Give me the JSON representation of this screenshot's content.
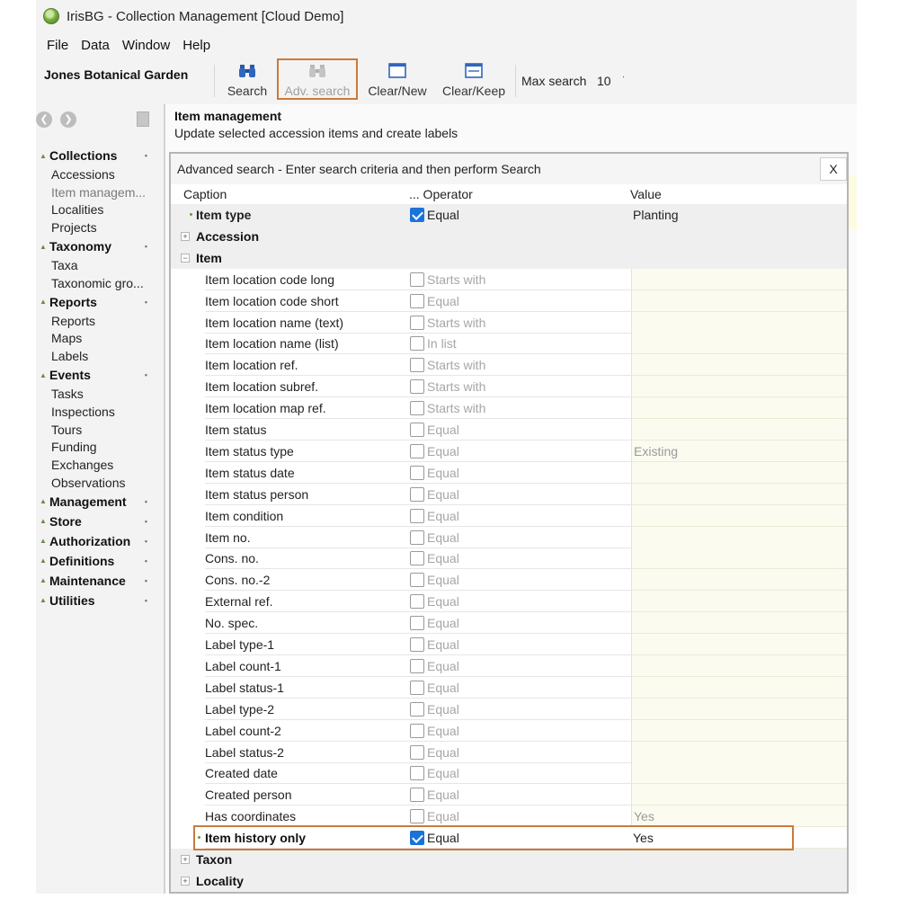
{
  "window": {
    "title": "IrisBG - Collection Management [Cloud Demo]"
  },
  "menu": [
    "File",
    "Data",
    "Window",
    "Help"
  ],
  "toolbar": {
    "org_name": "Jones Botanical Garden",
    "search_label": "Search",
    "adv_search_label": "Adv. search",
    "clear_new_label": "Clear/New",
    "clear_keep_label": "Clear/Keep",
    "max_search_label": "Max search",
    "max_search_value": "10"
  },
  "sidebar": {
    "groups": [
      {
        "label": "Collections",
        "items": [
          {
            "label": "Accessions",
            "dim": false
          },
          {
            "label": "Item managem...",
            "dim": true
          },
          {
            "label": "Localities",
            "dim": false
          },
          {
            "label": "Projects",
            "dim": false
          }
        ]
      },
      {
        "label": "Taxonomy",
        "items": [
          {
            "label": "Taxa",
            "dim": false
          },
          {
            "label": "Taxonomic gro...",
            "dim": false
          }
        ]
      },
      {
        "label": "Reports",
        "items": [
          {
            "label": "Reports",
            "dim": false
          },
          {
            "label": "Maps",
            "dim": false
          },
          {
            "label": "Labels",
            "dim": false
          }
        ]
      },
      {
        "label": "Events",
        "items": [
          {
            "label": "Tasks",
            "dim": false
          },
          {
            "label": "Inspections",
            "dim": false
          },
          {
            "label": "Tours",
            "dim": false
          },
          {
            "label": "Funding",
            "dim": false
          },
          {
            "label": "Exchanges",
            "dim": false
          },
          {
            "label": "Observations",
            "dim": false
          }
        ]
      },
      {
        "label": "Management",
        "items": []
      },
      {
        "label": "Store",
        "items": []
      },
      {
        "label": "Authorization",
        "items": []
      },
      {
        "label": "Definitions",
        "items": []
      },
      {
        "label": "Maintenance",
        "items": []
      },
      {
        "label": "Utilities",
        "items": []
      }
    ]
  },
  "main": {
    "title": "Item management",
    "description": "Update selected accession items and create labels"
  },
  "dialog": {
    "title": "Advanced search - Enter search criteria and then perform Search",
    "close_label": "X",
    "columns": {
      "caption": "Caption",
      "operator": "... Operator",
      "value": "Value"
    },
    "item_type_row": {
      "caption": "Item type",
      "checked": true,
      "operator": "Equal",
      "value": "Planting"
    },
    "groups": {
      "accession": "Accession",
      "item": "Item",
      "taxon": "Taxon",
      "locality": "Locality"
    },
    "item_rows": [
      {
        "caption": "Item location code long",
        "checked": false,
        "operator": "Starts with",
        "value": ""
      },
      {
        "caption": "Item location code short",
        "checked": false,
        "operator": "Equal",
        "value": ""
      },
      {
        "caption": "Item location name (text)",
        "checked": false,
        "operator": "Starts with",
        "value": ""
      },
      {
        "caption": "Item location name (list)",
        "checked": false,
        "operator": "In list",
        "value": ""
      },
      {
        "caption": "Item location ref.",
        "checked": false,
        "operator": "Starts with",
        "value": ""
      },
      {
        "caption": "Item location subref.",
        "checked": false,
        "operator": "Starts with",
        "value": ""
      },
      {
        "caption": "Item location map ref.",
        "checked": false,
        "operator": "Starts with",
        "value": ""
      },
      {
        "caption": "Item status",
        "checked": false,
        "operator": "Equal",
        "value": ""
      },
      {
        "caption": "Item status type",
        "checked": false,
        "operator": "Equal",
        "value": "Existing"
      },
      {
        "caption": "Item status date",
        "checked": false,
        "operator": "Equal",
        "value": ""
      },
      {
        "caption": "Item status person",
        "checked": false,
        "operator": "Equal",
        "value": ""
      },
      {
        "caption": "Item condition",
        "checked": false,
        "operator": "Equal",
        "value": ""
      },
      {
        "caption": "Item no.",
        "checked": false,
        "operator": "Equal",
        "value": ""
      },
      {
        "caption": "Cons. no.",
        "checked": false,
        "operator": "Equal",
        "value": ""
      },
      {
        "caption": "Cons. no.-2",
        "checked": false,
        "operator": "Equal",
        "value": ""
      },
      {
        "caption": "External ref.",
        "checked": false,
        "operator": "Equal",
        "value": ""
      },
      {
        "caption": "No. spec.",
        "checked": false,
        "operator": "Equal",
        "value": ""
      },
      {
        "caption": "Label type-1",
        "checked": false,
        "operator": "Equal",
        "value": ""
      },
      {
        "caption": "Label count-1",
        "checked": false,
        "operator": "Equal",
        "value": ""
      },
      {
        "caption": "Label status-1",
        "checked": false,
        "operator": "Equal",
        "value": ""
      },
      {
        "caption": "Label type-2",
        "checked": false,
        "operator": "Equal",
        "value": ""
      },
      {
        "caption": "Label count-2",
        "checked": false,
        "operator": "Equal",
        "value": ""
      },
      {
        "caption": "Label status-2",
        "checked": false,
        "operator": "Equal",
        "value": ""
      },
      {
        "caption": "Created date",
        "checked": false,
        "operator": "Equal",
        "value": ""
      },
      {
        "caption": "Created person",
        "checked": false,
        "operator": "Equal",
        "value": ""
      },
      {
        "caption": "Has coordinates",
        "checked": false,
        "operator": "Equal",
        "value": "Yes"
      },
      {
        "caption": "Item history only",
        "checked": true,
        "operator": "Equal",
        "value": "Yes",
        "selected": true
      }
    ]
  },
  "colors": {
    "highlight": "#cc7a3a",
    "checkbox_on": "#1a73d9",
    "value_bg": "#fbfbf0"
  }
}
